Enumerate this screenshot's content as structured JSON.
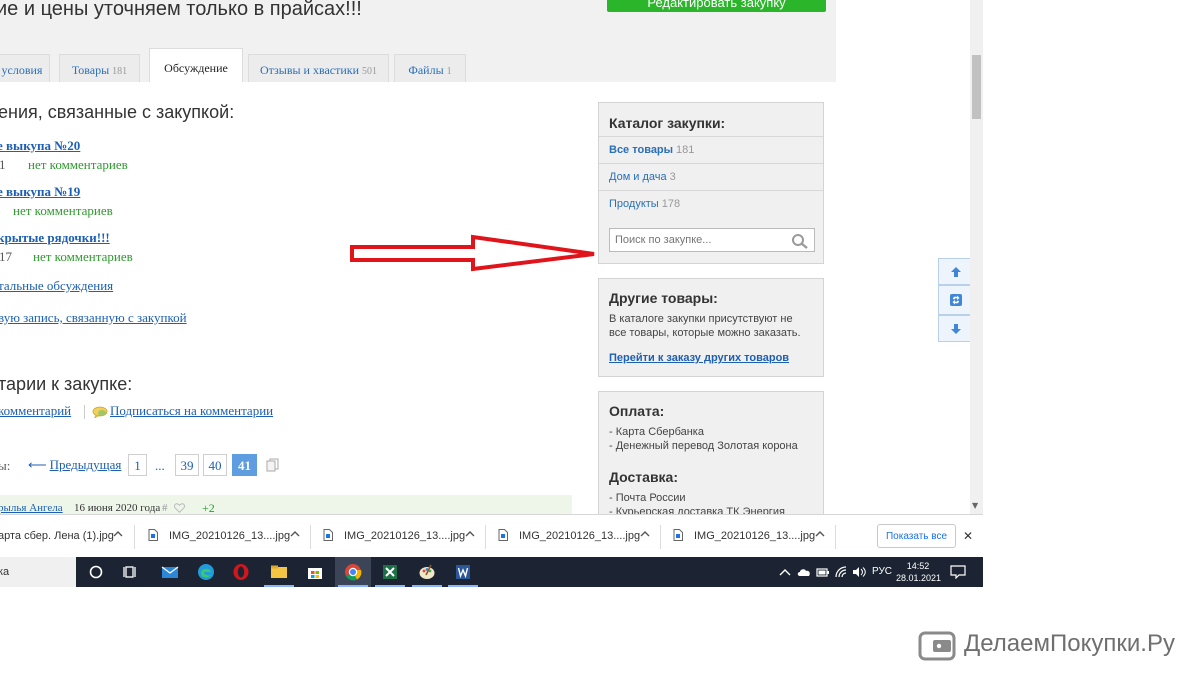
{
  "page": {
    "headline": "ие и цены уточняем только в прайсах!!!",
    "edit_button": "Редактировать закупку"
  },
  "tabs": [
    {
      "label": "условия",
      "count": ""
    },
    {
      "label": "Товары",
      "count": "181"
    },
    {
      "label": "Обсуждение",
      "count": ""
    },
    {
      "label": "Отзывы и хвастики",
      "count": "501"
    },
    {
      "label": "Файлы",
      "count": "1"
    }
  ],
  "discussions": {
    "heading": "ения, связанные с закупкой:",
    "items": [
      {
        "title": "е выкупа №20",
        "meta": "1",
        "comments": "нет комментариев"
      },
      {
        "title": "е выкупа №19",
        "meta": "",
        "comments": "нет комментариев"
      },
      {
        "title": "крытые рядочки!!!",
        "meta": "17",
        "comments": "нет комментариев"
      }
    ],
    "all_link": "тальные обсуждения",
    "new_link": "вую запись, связанную с закупкой"
  },
  "comments": {
    "heading": "тарии к закупке:",
    "add_link": "комментарий",
    "subscribe_link": "Подписаться на комментарии"
  },
  "pager": {
    "label": "ы:",
    "prev_arrow": "⟵",
    "prev": "Предыдущая",
    "pages": [
      "1",
      "...",
      "39",
      "40",
      "41"
    ],
    "current": "41"
  },
  "comment_row": {
    "author": "рылья Ангела",
    "date": "16 июня 2020 года",
    "hash": "#",
    "score": "+2"
  },
  "catalog": {
    "title": "Каталог закупки:",
    "items": [
      {
        "label": "Все товары",
        "count": "181"
      },
      {
        "label": "Дом и дача",
        "count": "3"
      },
      {
        "label": "Продукты",
        "count": "178"
      }
    ],
    "search_placeholder": "Поиск по закупке..."
  },
  "other_goods": {
    "title": "Другие товары:",
    "text_line1": "В каталоге закупки присутствуют не",
    "text_line2": "все товары, которые можно заказать.",
    "link": "Перейти к заказу других товаров"
  },
  "payment": {
    "title": "Оплата:",
    "lines": [
      "- Карта Сбербанка",
      "- Денежный перевод Золотая корона"
    ]
  },
  "delivery": {
    "title": "Доставка:",
    "lines": [
      "- Почта России",
      "- Курьерская доставка ТК Энергия"
    ]
  },
  "downloads": {
    "items": [
      "арта сбер. Лена (1).jpg",
      "IMG_20210126_13....jpg",
      "IMG_20210126_13....jpg",
      "IMG_20210126_13....jpg",
      "IMG_20210126_13....jpg"
    ],
    "show_all": "Показать все",
    "close": "✕"
  },
  "taskbar": {
    "search_text": "ка",
    "language": "РУС",
    "time": "14:52",
    "date": "28.01.2021"
  },
  "watermark": {
    "text": "ДелаемПокупки.Ру"
  },
  "colors": {
    "accent_blue": "#1d5fb2",
    "green": "#2e9a2e",
    "arrow_red": "#e0141b",
    "taskbar": "#1c2433"
  }
}
